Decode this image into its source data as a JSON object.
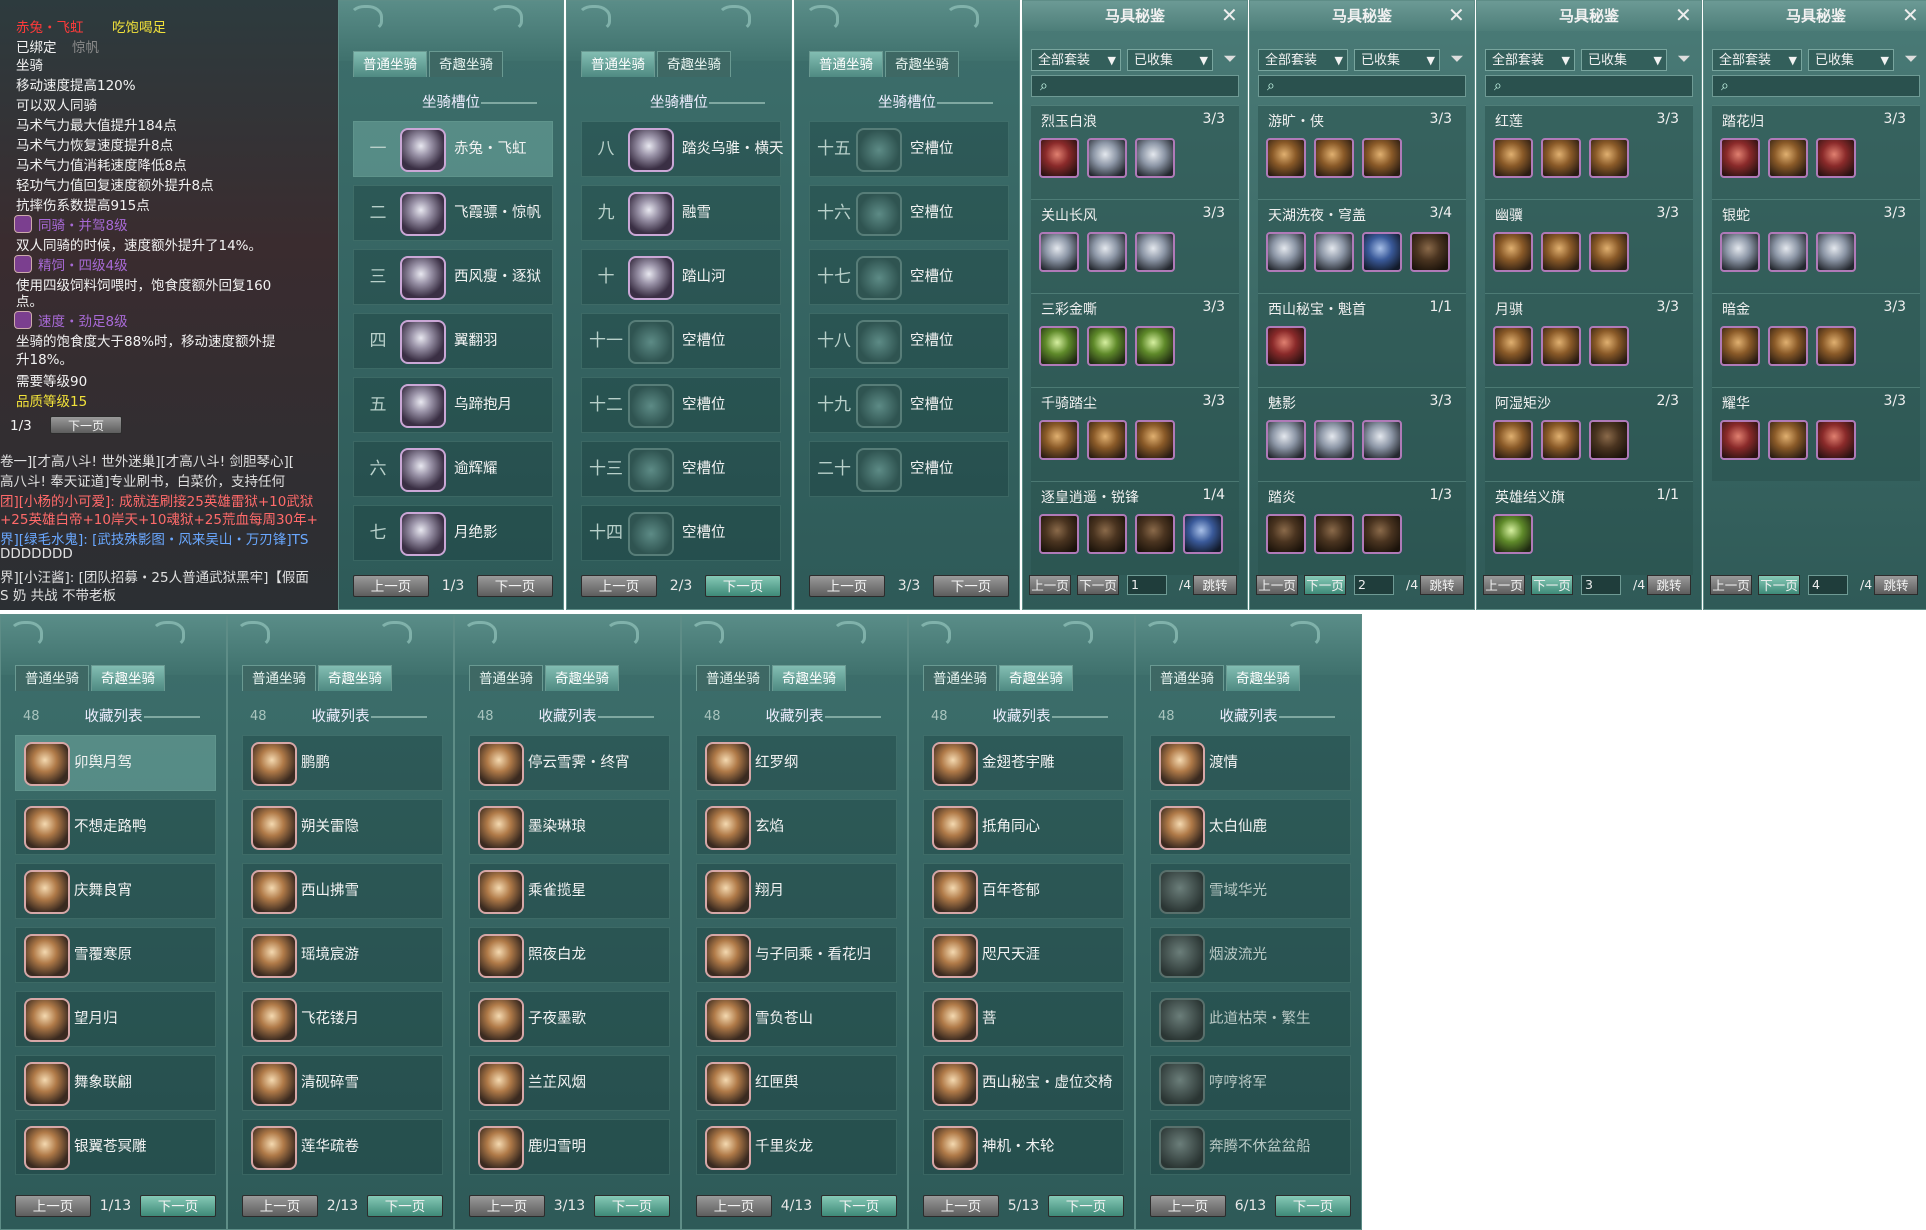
{
  "tooltip": {
    "lines": [
      {
        "t": "赤兔・飞虹",
        "c": "#ff3a3a"
      },
      {
        "t": "已绑定",
        "c": "#f2f2f2"
      },
      {
        "t": "坐骑",
        "c": "#f2f2f2"
      },
      {
        "t": "移动速度提高120%",
        "c": "#f2f2f2"
      },
      {
        "t": "可以双人同骑",
        "c": "#f2f2f2"
      },
      {
        "t": "马术气力最大值提升184点",
        "c": "#f2f2f2"
      },
      {
        "t": "马术气力恢复速度提升8点",
        "c": "#f2f2f2"
      },
      {
        "t": "马术气力值消耗速度降低8点",
        "c": "#f2f2f2"
      },
      {
        "t": "轻功气力值回复速度额外提升8点",
        "c": "#f2f2f2"
      },
      {
        "t": "抗摔伤系数提高915点",
        "c": "#f2f2f2"
      },
      {
        "t": "同骑・并驾8级",
        "c": "#a86ad6"
      },
      {
        "t": "双人同骑的时候，速度额外提升了14%。",
        "c": "#f2f2f2"
      },
      {
        "t": "精饲・四级4级",
        "c": "#a86ad6"
      },
      {
        "t": "使用四级饲料饲喂时，饱食度额外回复160",
        "c": "#f2f2f2"
      },
      {
        "t": "点。",
        "c": "#f2f2f2"
      },
      {
        "t": "速度・劲足8级",
        "c": "#a86ad6"
      },
      {
        "t": "坐骑的饱食度大于88%时，移动速度额外提",
        "c": "#f2f2f2"
      },
      {
        "t": "升18%。",
        "c": "#f2f2f2"
      },
      {
        "t": "需要等级90",
        "c": "#f2f2f2"
      },
      {
        "t": "品质等级15",
        "c": "#f2e23a"
      }
    ],
    "title_extra": "吃饱喝足",
    "bound_extra": "惊帆",
    "page": "1/3",
    "next": "下一页"
  },
  "chat": [
    {
      "t": "卷一][才高八斗! 世外迷巢][才高八斗! 剑胆琴心][",
      "c": "#e0e0e0"
    },
    {
      "t": "高八斗! 奉天证道]专业刷书，白菜价，支持任何",
      "c": "#e0e0e0"
    },
    {
      "t": "团][小杨的小可爱]: 成就连刷接25英雄雷狱+10武狱",
      "c": "#ff6a6a"
    },
    {
      "t": "+25英雄白帝+10岸天+10魂狱+25荒血每周30年+",
      "c": "#ff6a6a"
    },
    {
      "t": "界][绿毛水鬼]: [武技殊影图・风来吴山・万刃锋]TS",
      "c": "#6aa8ff"
    },
    {
      "t": "DDDDDDD",
      "c": "#e0e0e0"
    },
    {
      "t": "界][小汪酱]: [团队招募・25人普通武狱黑牢]【假面",
      "c": "#e0e0e0"
    },
    {
      "t": "S 奶 共战 不带老板",
      "c": "#e0e0e0"
    }
  ],
  "tabs": {
    "normal": "普通坐骑",
    "fun": "奇趣坐骑"
  },
  "slot_title": "坐骑槽位",
  "collect_title": "收藏列表",
  "level_hint": "48",
  "prev": "上一页",
  "next": "下一页",
  "slot_panels": [
    {
      "page": "1/3",
      "rows": [
        {
          "o": "一",
          "n": "赤兔・飞虹",
          "e": false,
          "hl": true
        },
        {
          "o": "二",
          "n": "飞霞骠・惊帆",
          "e": false
        },
        {
          "o": "三",
          "n": "西风瘦・逐狱",
          "e": false
        },
        {
          "o": "四",
          "n": "翼翻羽",
          "e": false
        },
        {
          "o": "五",
          "n": "乌蹄抱月",
          "e": false
        },
        {
          "o": "六",
          "n": "逾辉耀",
          "e": false
        },
        {
          "o": "七",
          "n": "月绝影",
          "e": false
        }
      ]
    },
    {
      "page": "2/3",
      "rows": [
        {
          "o": "八",
          "n": "踏炎乌骓・横天",
          "e": false
        },
        {
          "o": "九",
          "n": "融雪",
          "e": false
        },
        {
          "o": "十",
          "n": "踏山河",
          "e": false
        },
        {
          "o": "十一",
          "n": "空槽位",
          "e": true
        },
        {
          "o": "十二",
          "n": "空槽位",
          "e": true
        },
        {
          "o": "十三",
          "n": "空槽位",
          "e": true
        },
        {
          "o": "十四",
          "n": "空槽位",
          "e": true
        }
      ]
    },
    {
      "page": "3/3",
      "rows": [
        {
          "o": "十五",
          "n": "空槽位",
          "e": true
        },
        {
          "o": "十六",
          "n": "空槽位",
          "e": true
        },
        {
          "o": "十七",
          "n": "空槽位",
          "e": true
        },
        {
          "o": "十八",
          "n": "空槽位",
          "e": true
        },
        {
          "o": "十九",
          "n": "空槽位",
          "e": true
        },
        {
          "o": "二十",
          "n": "空槽位",
          "e": true
        }
      ]
    }
  ],
  "equip_title": "马具秘鉴",
  "equip_filter": {
    "all": "全部套装",
    "collected": "已收集",
    "jump": "跳转",
    "prev": "上一页",
    "next": "下一页",
    "total": "/4"
  },
  "equip_panels": [
    {
      "page": "1",
      "sets": [
        {
          "n": "烈玉白浪",
          "c": "3/3",
          "items": [
            "r",
            "s",
            "s"
          ]
        },
        {
          "n": "关山长风",
          "c": "3/3",
          "items": [
            "s",
            "s",
            "s"
          ]
        },
        {
          "n": "三彩金嘶",
          "c": "3/3",
          "items": [
            "g",
            "g",
            "g"
          ]
        },
        {
          "n": "千骑踏尘",
          "c": "3/3",
          "items": [
            "",
            "",
            ""
          ]
        },
        {
          "n": "逐皇逍遥・锐锋",
          "c": "1/4",
          "items": [
            "dk",
            "dk",
            "dk",
            "b"
          ]
        }
      ]
    },
    {
      "page": "2",
      "sets": [
        {
          "n": "游旷・侠",
          "c": "3/3",
          "items": [
            "",
            "",
            ""
          ]
        },
        {
          "n": "天湖洗夜・穹盖",
          "c": "3/4",
          "items": [
            "s",
            "s",
            "b",
            "dk"
          ]
        },
        {
          "n": "西山秘宝・魁首",
          "c": "1/1",
          "items": [
            "r"
          ]
        },
        {
          "n": "魅影",
          "c": "3/3",
          "items": [
            "s",
            "s",
            "s"
          ]
        },
        {
          "n": "踏炎",
          "c": "1/3",
          "items": [
            "dk",
            "dk",
            "dk"
          ]
        }
      ]
    },
    {
      "page": "3",
      "sets": [
        {
          "n": "红莲",
          "c": "3/3",
          "items": [
            "",
            "",
            ""
          ]
        },
        {
          "n": "幽骥",
          "c": "3/3",
          "items": [
            "",
            "",
            ""
          ]
        },
        {
          "n": "月骐",
          "c": "3/3",
          "items": [
            "",
            "",
            ""
          ]
        },
        {
          "n": "阿湿矩沙",
          "c": "2/3",
          "items": [
            "",
            "",
            "dk"
          ]
        },
        {
          "n": "英雄结义旗",
          "c": "1/1",
          "items": [
            "g"
          ]
        }
      ]
    },
    {
      "page": "4",
      "sets": [
        {
          "n": "踏花归",
          "c": "3/3",
          "items": [
            "r",
            "",
            "r"
          ]
        },
        {
          "n": "银蛇",
          "c": "3/3",
          "items": [
            "s",
            "s",
            "s"
          ]
        },
        {
          "n": "暗金",
          "c": "3/3",
          "items": [
            "",
            "",
            ""
          ]
        },
        {
          "n": "耀华",
          "c": "3/3",
          "items": [
            "r",
            "",
            "r"
          ]
        }
      ]
    }
  ],
  "collect_panels": [
    {
      "page": "1/13",
      "rows": [
        {
          "n": "卯舆月驾"
        },
        {
          "n": "不想走路鸭"
        },
        {
          "n": "庆舞良宵"
        },
        {
          "n": "雪覆寒原"
        },
        {
          "n": "望月归"
        },
        {
          "n": "舞象联翩"
        },
        {
          "n": "银翼苍冥雕"
        }
      ]
    },
    {
      "page": "2/13",
      "rows": [
        {
          "n": "鹏鹏"
        },
        {
          "n": "朔关雷隐"
        },
        {
          "n": "西山拂雪"
        },
        {
          "n": "瑶境宸游"
        },
        {
          "n": "飞花镂月"
        },
        {
          "n": "清砚碎雪"
        },
        {
          "n": "莲华疏卷"
        }
      ]
    },
    {
      "page": "3/13",
      "rows": [
        {
          "n": "停云雪霁・终宵"
        },
        {
          "n": "墨染琳琅"
        },
        {
          "n": "乘雀揽星"
        },
        {
          "n": "照夜白龙"
        },
        {
          "n": "子夜墨歌"
        },
        {
          "n": "兰芷风烟"
        },
        {
          "n": "鹿归雪明"
        }
      ]
    },
    {
      "page": "4/13",
      "rows": [
        {
          "n": "红罗纲"
        },
        {
          "n": "玄焰"
        },
        {
          "n": "翔月"
        },
        {
          "n": "与子同乘・看花归"
        },
        {
          "n": "雪负苍山"
        },
        {
          "n": "红匣舆"
        },
        {
          "n": "千里炎龙"
        }
      ]
    },
    {
      "page": "5/13",
      "rows": [
        {
          "n": "金翅苍宇雕"
        },
        {
          "n": "抵角同心"
        },
        {
          "n": "百年苍郁"
        },
        {
          "n": "咫尺天涯"
        },
        {
          "n": "菩"
        },
        {
          "n": "西山秘宝・虚位交椅"
        },
        {
          "n": "神机・木轮"
        }
      ]
    },
    {
      "page": "6/13",
      "rows": [
        {
          "n": "渡情"
        },
        {
          "n": "太白仙鹿"
        },
        {
          "n": "雪域华光",
          "d": true
        },
        {
          "n": "烟波流光",
          "d": true
        },
        {
          "n": "此道枯荣・繁生",
          "d": true
        },
        {
          "n": "哼哼将军",
          "d": true
        },
        {
          "n": "奔腾不休盆盆船",
          "d": true
        }
      ]
    }
  ]
}
